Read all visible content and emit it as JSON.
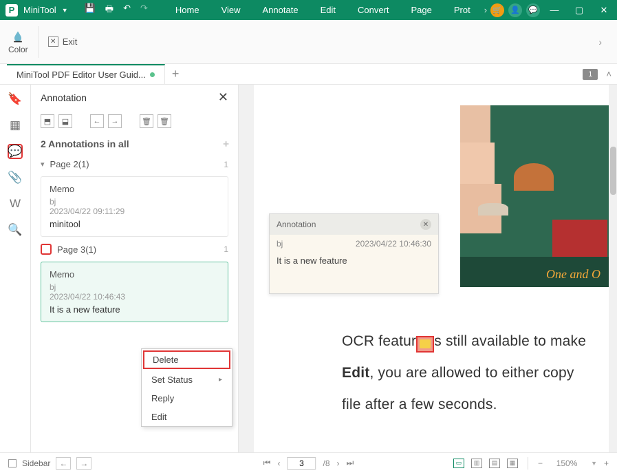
{
  "titlebar": {
    "brand": "MiniTool",
    "menus": [
      "Home",
      "View",
      "Annotate",
      "Edit",
      "Convert",
      "Page",
      "Prot"
    ]
  },
  "ribbon": {
    "color_label": "Color",
    "exit_label": "Exit"
  },
  "tabs": {
    "active": "MiniTool PDF Editor User Guid...",
    "page_badge": "1"
  },
  "annotation_panel": {
    "title": "Annotation",
    "count_label": "2 Annotations in all",
    "groups": [
      {
        "label": "Page 2(1)",
        "count": "1",
        "items": [
          {
            "title": "Memo",
            "author": "bj",
            "timestamp": "2023/04/22 09:11:29",
            "body": "minitool"
          }
        ]
      },
      {
        "label": "Page 3(1)",
        "count": "1",
        "items": [
          {
            "title": "Memo",
            "author": "bj",
            "timestamp": "2023/04/22 10:46:43",
            "body": "It is a new feature"
          }
        ]
      }
    ]
  },
  "context_menu": {
    "delete": "Delete",
    "set_status": "Set Status",
    "reply": "Reply",
    "edit": "Edit"
  },
  "popup": {
    "title": "Annotation",
    "author": "bj",
    "timestamp": "2023/04/22 10:46:30",
    "body": "It is a new feature"
  },
  "retro_image": {
    "script_text": "One and O"
  },
  "doc_text": {
    "line1_a": "OCR featur",
    "line1_b": "s still available to make",
    "line2_a": "Edit",
    "line2_b": ", you are allowed to either copy",
    "line3": "file after a few seconds."
  },
  "statusbar": {
    "sidebar_label": "Sidebar",
    "current_page": "3",
    "total_pages": "/8",
    "zoom": "150%"
  }
}
